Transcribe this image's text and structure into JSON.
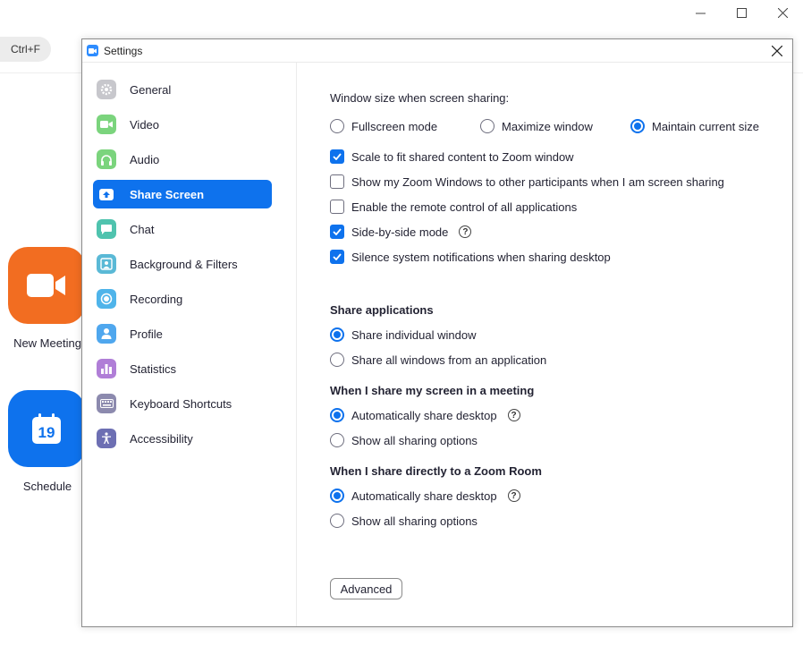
{
  "background": {
    "shortcut_hint": "Ctrl+F",
    "buttons": [
      {
        "label": "New Meeting",
        "icon": "video-camera-icon",
        "color": "#f26d21"
      },
      {
        "label": "Schedule",
        "icon": "calendar-icon",
        "color": "#0e72ed",
        "day": "19"
      }
    ],
    "window_controls": [
      "minimize",
      "maximize",
      "close"
    ]
  },
  "dialog": {
    "title": "Settings",
    "close_glyph": "✕"
  },
  "sidebar": {
    "items": [
      {
        "label": "General",
        "icon": "gear-icon",
        "color": "#c7c7cc",
        "active": false
      },
      {
        "label": "Video",
        "icon": "video-camera-icon",
        "color": "#7bd47d",
        "active": false
      },
      {
        "label": "Audio",
        "icon": "headphones-icon",
        "color": "#7bd47d",
        "active": false
      },
      {
        "label": "Share Screen",
        "icon": "share-screen-icon",
        "color": "#ffffff",
        "active": true
      },
      {
        "label": "Chat",
        "icon": "chat-bubble-icon",
        "color": "#4fc3ae",
        "active": false
      },
      {
        "label": "Background & Filters",
        "icon": "person-portrait-icon",
        "color": "#5ab9d6",
        "active": false
      },
      {
        "label": "Recording",
        "icon": "record-icon",
        "color": "#4fb4ea",
        "active": false
      },
      {
        "label": "Profile",
        "icon": "profile-icon",
        "color": "#4fa7ee",
        "active": false
      },
      {
        "label": "Statistics",
        "icon": "bar-chart-icon",
        "color": "#b07ed7",
        "active": false
      },
      {
        "label": "Keyboard Shortcuts",
        "icon": "keyboard-icon",
        "color": "#8c8aae",
        "active": false
      },
      {
        "label": "Accessibility",
        "icon": "accessibility-icon",
        "color": "#6d6fb3",
        "active": false
      }
    ]
  },
  "share_screen": {
    "window_size_label": "Window size when screen sharing:",
    "window_size_options": [
      {
        "label": "Fullscreen mode",
        "selected": false
      },
      {
        "label": "Maximize window",
        "selected": false
      },
      {
        "label": "Maintain current size",
        "selected": true
      }
    ],
    "checkboxes": [
      {
        "label": "Scale to fit shared content to Zoom window",
        "checked": true,
        "help": false
      },
      {
        "label": "Show my Zoom Windows to other participants when I am screen sharing",
        "checked": false,
        "help": false
      },
      {
        "label": "Enable the remote control of all applications",
        "checked": false,
        "help": false
      },
      {
        "label": "Side-by-side mode",
        "checked": true,
        "help": true
      },
      {
        "label": "Silence system notifications when sharing desktop",
        "checked": true,
        "help": false
      }
    ],
    "share_applications": {
      "heading": "Share applications",
      "options": [
        {
          "label": "Share individual window",
          "selected": true
        },
        {
          "label": "Share all windows from an application",
          "selected": false
        }
      ]
    },
    "meeting_share": {
      "heading": "When I share my screen in a meeting",
      "options": [
        {
          "label": "Automatically share desktop",
          "selected": true,
          "help": true
        },
        {
          "label": "Show all sharing options",
          "selected": false
        }
      ]
    },
    "zoom_room_share": {
      "heading": "When I share directly to a Zoom Room",
      "options": [
        {
          "label": "Automatically share desktop",
          "selected": true,
          "help": true
        },
        {
          "label": "Show all sharing options",
          "selected": false
        }
      ]
    },
    "advanced_label": "Advanced",
    "help_glyph": "?",
    "accent_color": "#0e72ed"
  }
}
